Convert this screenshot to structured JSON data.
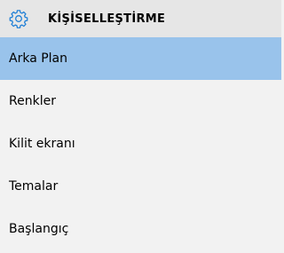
{
  "header": {
    "icon": "gear-icon",
    "title": "KİŞİSELLEŞTİRME"
  },
  "accent_color": "#99c3eb",
  "sidebar": {
    "selected_index": 0,
    "items": [
      {
        "label": "Arka Plan"
      },
      {
        "label": "Renkler"
      },
      {
        "label": "Kilit ekranı"
      },
      {
        "label": "Temalar"
      },
      {
        "label": "Başlangıç"
      }
    ]
  }
}
